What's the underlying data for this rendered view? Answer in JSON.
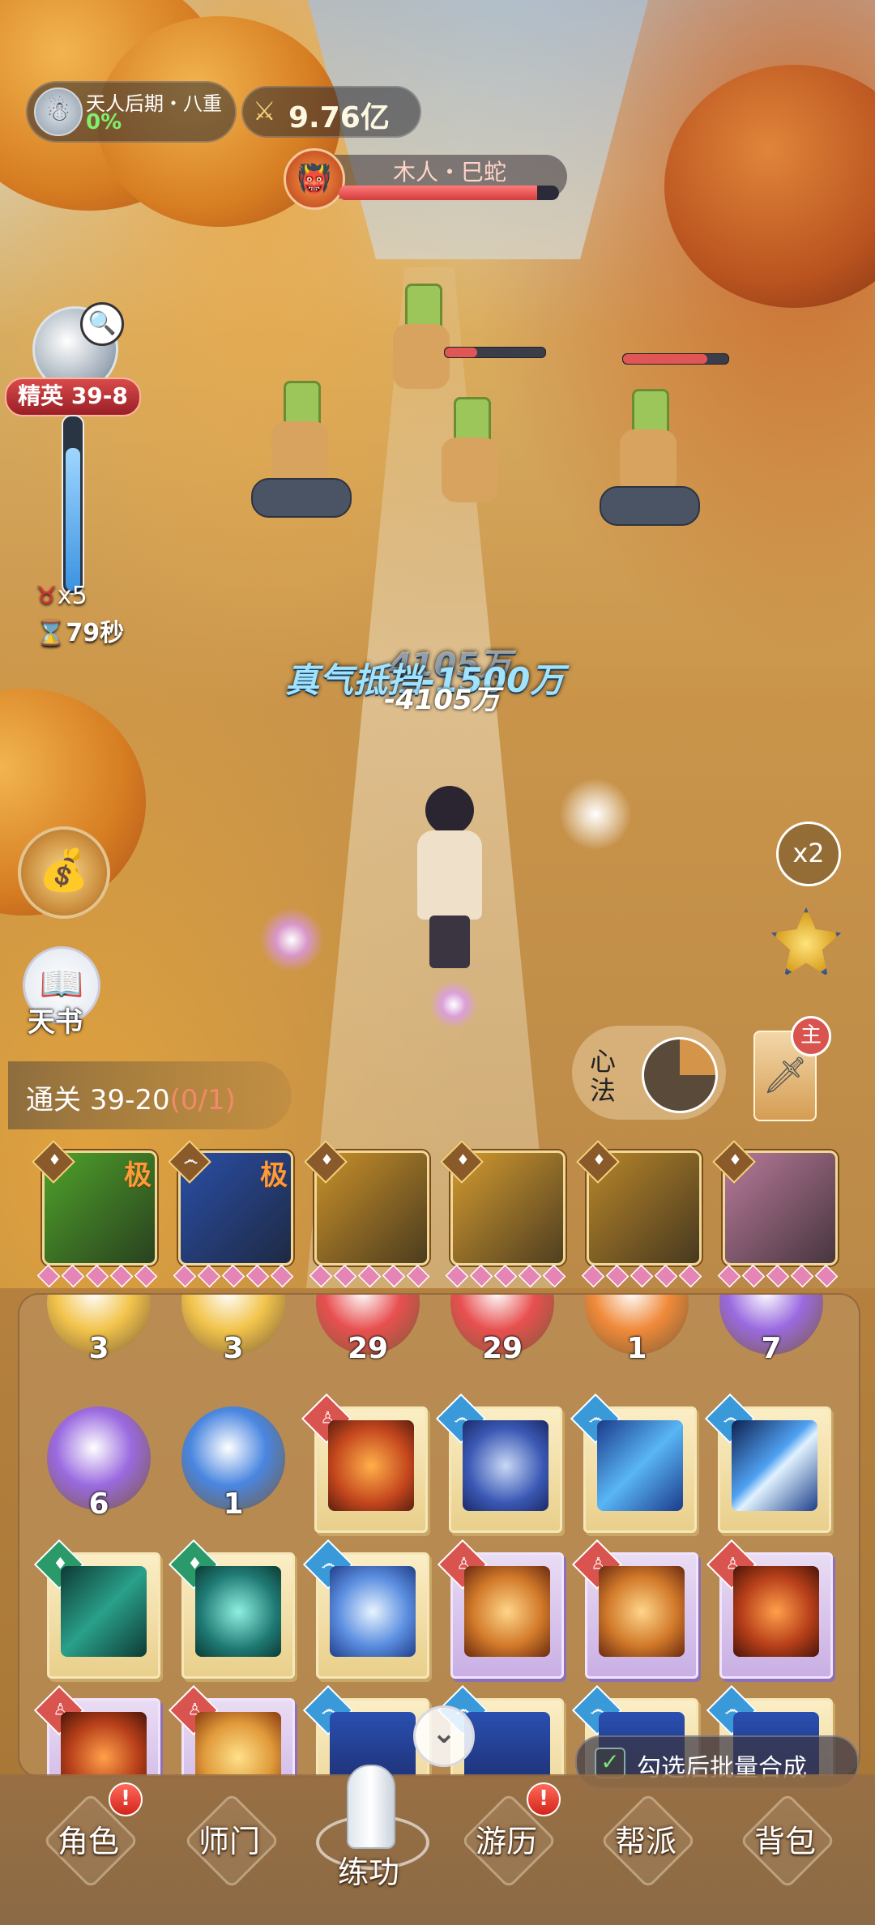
{
  "hud": {
    "realm_name": "天人后期・八重",
    "realm_progress": "0%",
    "combat_power": "9.76亿",
    "boss_name": "木人・巳蛇",
    "boss_hp_fraction": 0.9
  },
  "stage": {
    "badge": "精英 39-8",
    "kills_label": "x5",
    "time_left": "79秒",
    "time_fraction": 0.82
  },
  "floating_text": {
    "block": "真气抵挡-1500万",
    "damage": "-4105万",
    "ghost": "4105万"
  },
  "side_buttons": {
    "book_label": "天书",
    "speed_label": "x2",
    "xinfa_label": "心法",
    "main_tag": "主"
  },
  "progress": {
    "prefix": "通关 39-20",
    "count": "(0/1)"
  },
  "skills": [
    {
      "element": "insight-icon",
      "grade": "极",
      "color": "#4fa22a",
      "pips": 5
    },
    {
      "element": "water-icon",
      "grade": "极",
      "color": "#2a4fa8",
      "pips": 5
    },
    {
      "element": "insight-icon",
      "grade": "",
      "color": "#c9912a",
      "pips": 5
    },
    {
      "element": "insight-icon",
      "grade": "",
      "color": "#d39a30",
      "pips": 5
    },
    {
      "element": "insight-icon",
      "grade": "",
      "color": "#b8862a",
      "pips": 5
    },
    {
      "element": "insight-icon",
      "grade": "",
      "color": "#b87a9a",
      "pips": 5
    }
  ],
  "inventory": {
    "orbs": [
      {
        "count": "3",
        "color": "#f2c44c"
      },
      {
        "count": "3",
        "color": "#f2c44c"
      },
      {
        "count": "29",
        "color": "#e85050"
      },
      {
        "count": "29",
        "color": "#e85050"
      },
      {
        "count": "1",
        "color": "#f08a3a"
      },
      {
        "count": "7",
        "color": "#9a6ae0"
      },
      {
        "count": "6",
        "color": "#9a6ae0"
      },
      {
        "count": "1",
        "color": "#4a86e0"
      }
    ],
    "batch_label": "勾选后批量合成"
  },
  "nav": {
    "tabs": [
      "角色",
      "师门",
      "练功",
      "游历",
      "帮派",
      "背包"
    ],
    "active": "练功",
    "badge": "!"
  },
  "colors": {
    "accent_red": "#d84a4a",
    "hp_red": "#e05656",
    "realm_green": "#7ff06d"
  }
}
